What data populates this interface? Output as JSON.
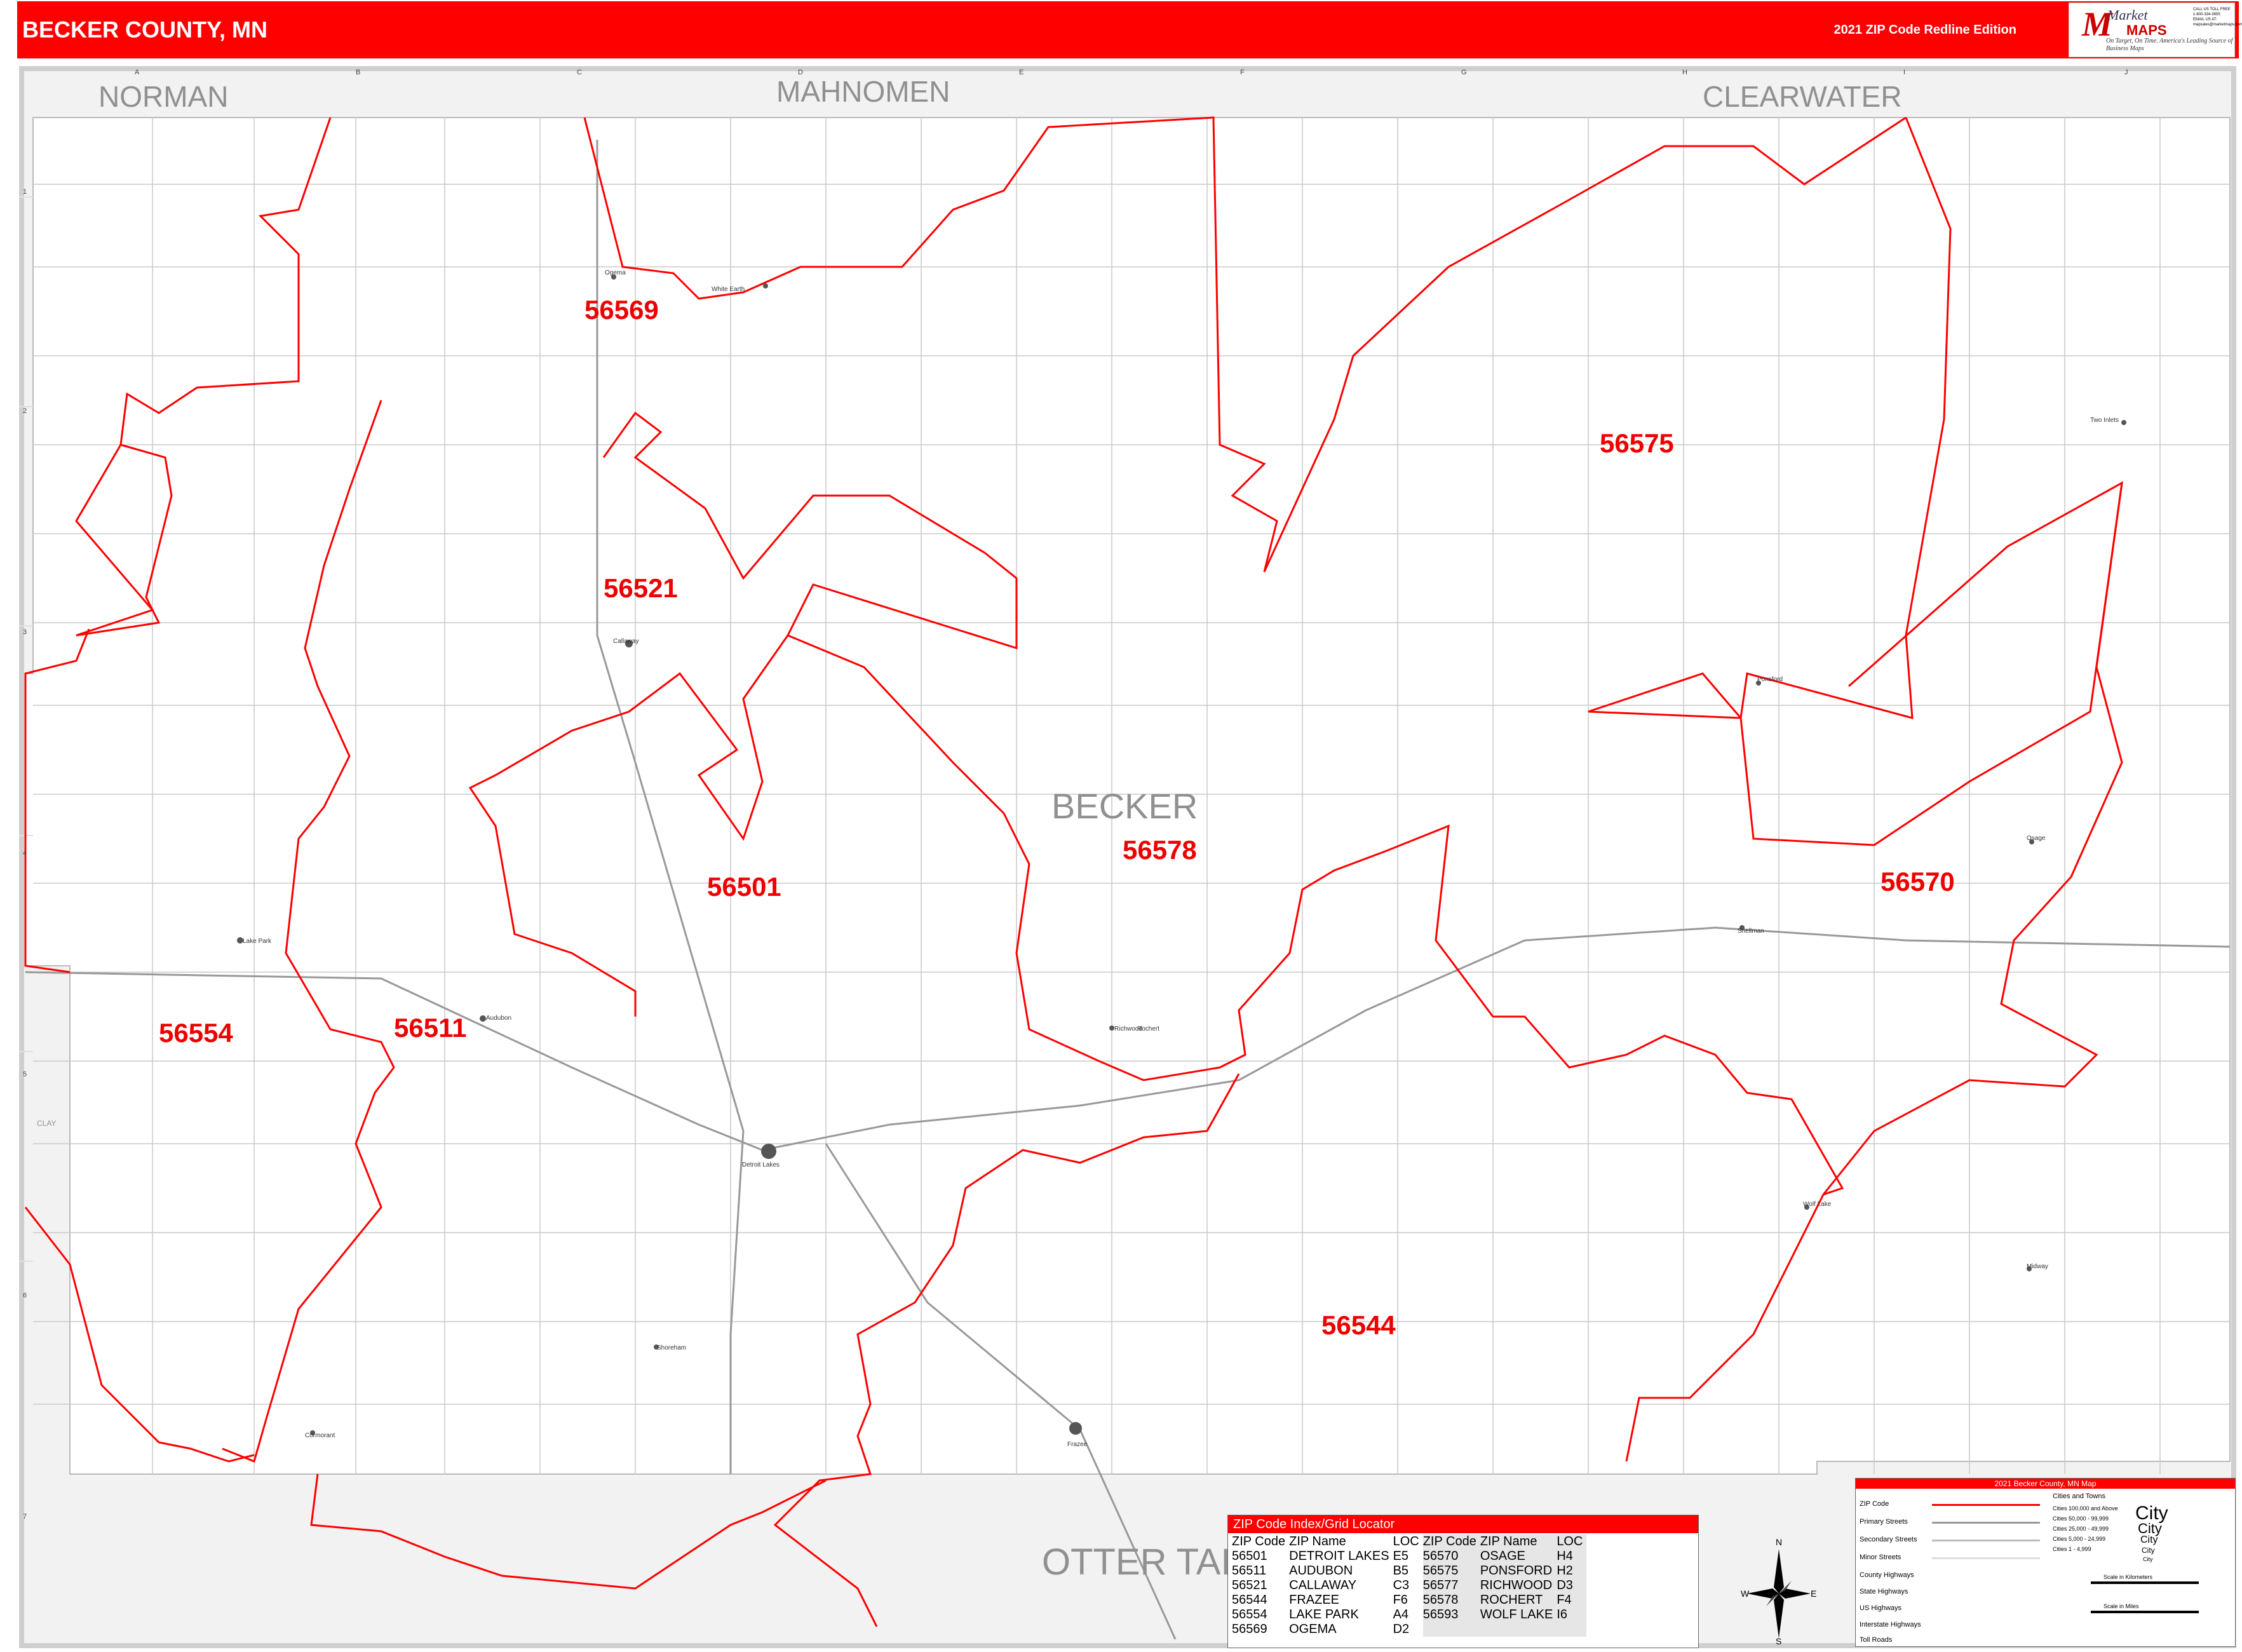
{
  "header": {
    "title": "BECKER COUNTY, MN",
    "edition": "2021 ZIP Code Redline Edition",
    "logo_brand": "Market",
    "logo_brand2": "MAPS",
    "logo_tag": "On Target, On Time. America's Leading Source of Business Maps",
    "logo_phone": "CALL US TOLL FREE 1-800-334-3655 EMAIL US AT: mapsales@marketmaps.com"
  },
  "colors": {
    "accent": "#ff0000",
    "background": "#f2f2f2",
    "county": "#ffffff"
  },
  "grid": {
    "columns": [
      "A",
      "B",
      "C",
      "D",
      "E",
      "F",
      "G",
      "H",
      "I",
      "J"
    ],
    "rows": [
      "1",
      "2",
      "3",
      "4",
      "5",
      "6",
      "7"
    ]
  },
  "neighbors": {
    "north_west": "NORMAN",
    "north": "MAHNOMEN",
    "north_east": "CLEARWATER",
    "south": "OTTER TAIL",
    "west": "CLAY"
  },
  "county_label": "BECKER",
  "zip_labels": [
    "56569",
    "56575",
    "56521",
    "56578",
    "56501",
    "56570",
    "56554",
    "56511",
    "56544"
  ],
  "towns": [
    "Ogema",
    "White Earth",
    "Callaway",
    "Ponsford",
    "Two Inlets",
    "Osage",
    "Lake Park",
    "Audubon",
    "Richwood",
    "Detroit Lakes",
    "Shoreham",
    "Cormorant",
    "Frazee",
    "Rochert",
    "Wolf Lake",
    "Midway",
    "Snellman"
  ],
  "zip_index": {
    "title": "ZIP Code Index/Grid Locator",
    "columns": [
      "ZIP Code",
      "ZIP Name",
      "LOC",
      "ZIP Code",
      "ZIP Name",
      "LOC"
    ],
    "rows": [
      [
        "56501",
        "DETROIT LAKES",
        "E5",
        "56570",
        "OSAGE",
        "H4"
      ],
      [
        "56511",
        "AUDUBON",
        "B5",
        "56575",
        "PONSFORD",
        "H2"
      ],
      [
        "56521",
        "CALLAWAY",
        "C3",
        "56577",
        "RICHWOOD",
        "D3"
      ],
      [
        "56544",
        "FRAZEE",
        "F6",
        "56578",
        "ROCHERT",
        "F4"
      ],
      [
        "56554",
        "LAKE PARK",
        "A4",
        "56593",
        "WOLF LAKE",
        "I6"
      ],
      [
        "56569",
        "OGEMA",
        "D2",
        "",
        "",
        ""
      ]
    ]
  },
  "map_legend": {
    "title": "2021 Becker County, MN Map",
    "items": [
      "ZIP Code",
      "Primary Streets",
      "Secondary Streets",
      "Minor Streets",
      "County Highways",
      "State Highways",
      "US Highways",
      "Interstate Highways",
      "Toll Roads"
    ],
    "cities_title": "Cities and Towns",
    "cities": [
      "Cities 100,000 and Above",
      "Cities 50,000 - 99,999",
      "Cities 25,000 - 49,999",
      "Cities 5,000 - 24,999",
      "Cities 1 - 4,999"
    ],
    "city_samples": [
      "City",
      "City",
      "City",
      "City",
      "City"
    ],
    "scale_km": "Scale in Kilometers",
    "scale_mi": "Scale in Miles"
  },
  "compass": {
    "n": "N",
    "s": "S",
    "e": "E",
    "w": "W"
  }
}
